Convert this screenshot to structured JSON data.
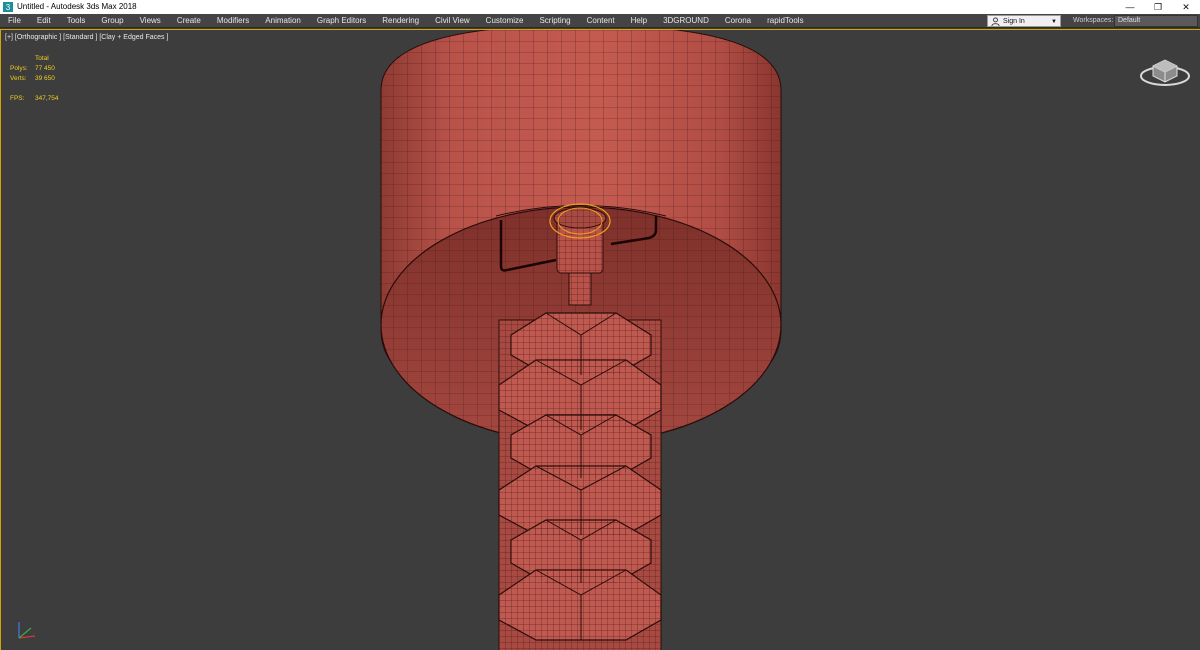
{
  "window": {
    "title": "Untitled - Autodesk 3ds Max 2018",
    "controls": [
      "—",
      "❐",
      "✕"
    ]
  },
  "menu": {
    "items": [
      "File",
      "Edit",
      "Tools",
      "Group",
      "Views",
      "Create",
      "Modifiers",
      "Animation",
      "Graph Editors",
      "Rendering",
      "Civil View",
      "Customize",
      "Scripting",
      "Content",
      "Help",
      "3DGROUND",
      "Corona",
      "rapidTools"
    ]
  },
  "account": {
    "signin_label": "Sign In",
    "workspaces_label": "Workspaces:",
    "workspace_value": "Default"
  },
  "viewport": {
    "label": "[+] [Orthographic ] [Standard ] [Clay + Edged Faces ]",
    "stats": {
      "header": "Total",
      "polys_label": "Polys:",
      "polys_value": "77 450",
      "verts_label": "Verts:",
      "verts_value": "39 650",
      "fps_label": "FPS:",
      "fps_value": "347,754"
    }
  },
  "colors": {
    "viewport_bg": "#3d3d3d",
    "clay": "#b9534a",
    "wire": "#3a1210",
    "selection": "#f0a020",
    "stats_text": "#f0d020"
  },
  "icons": [
    "app-icon",
    "user-icon",
    "viewcube-icon",
    "axis-tripod-icon"
  ]
}
